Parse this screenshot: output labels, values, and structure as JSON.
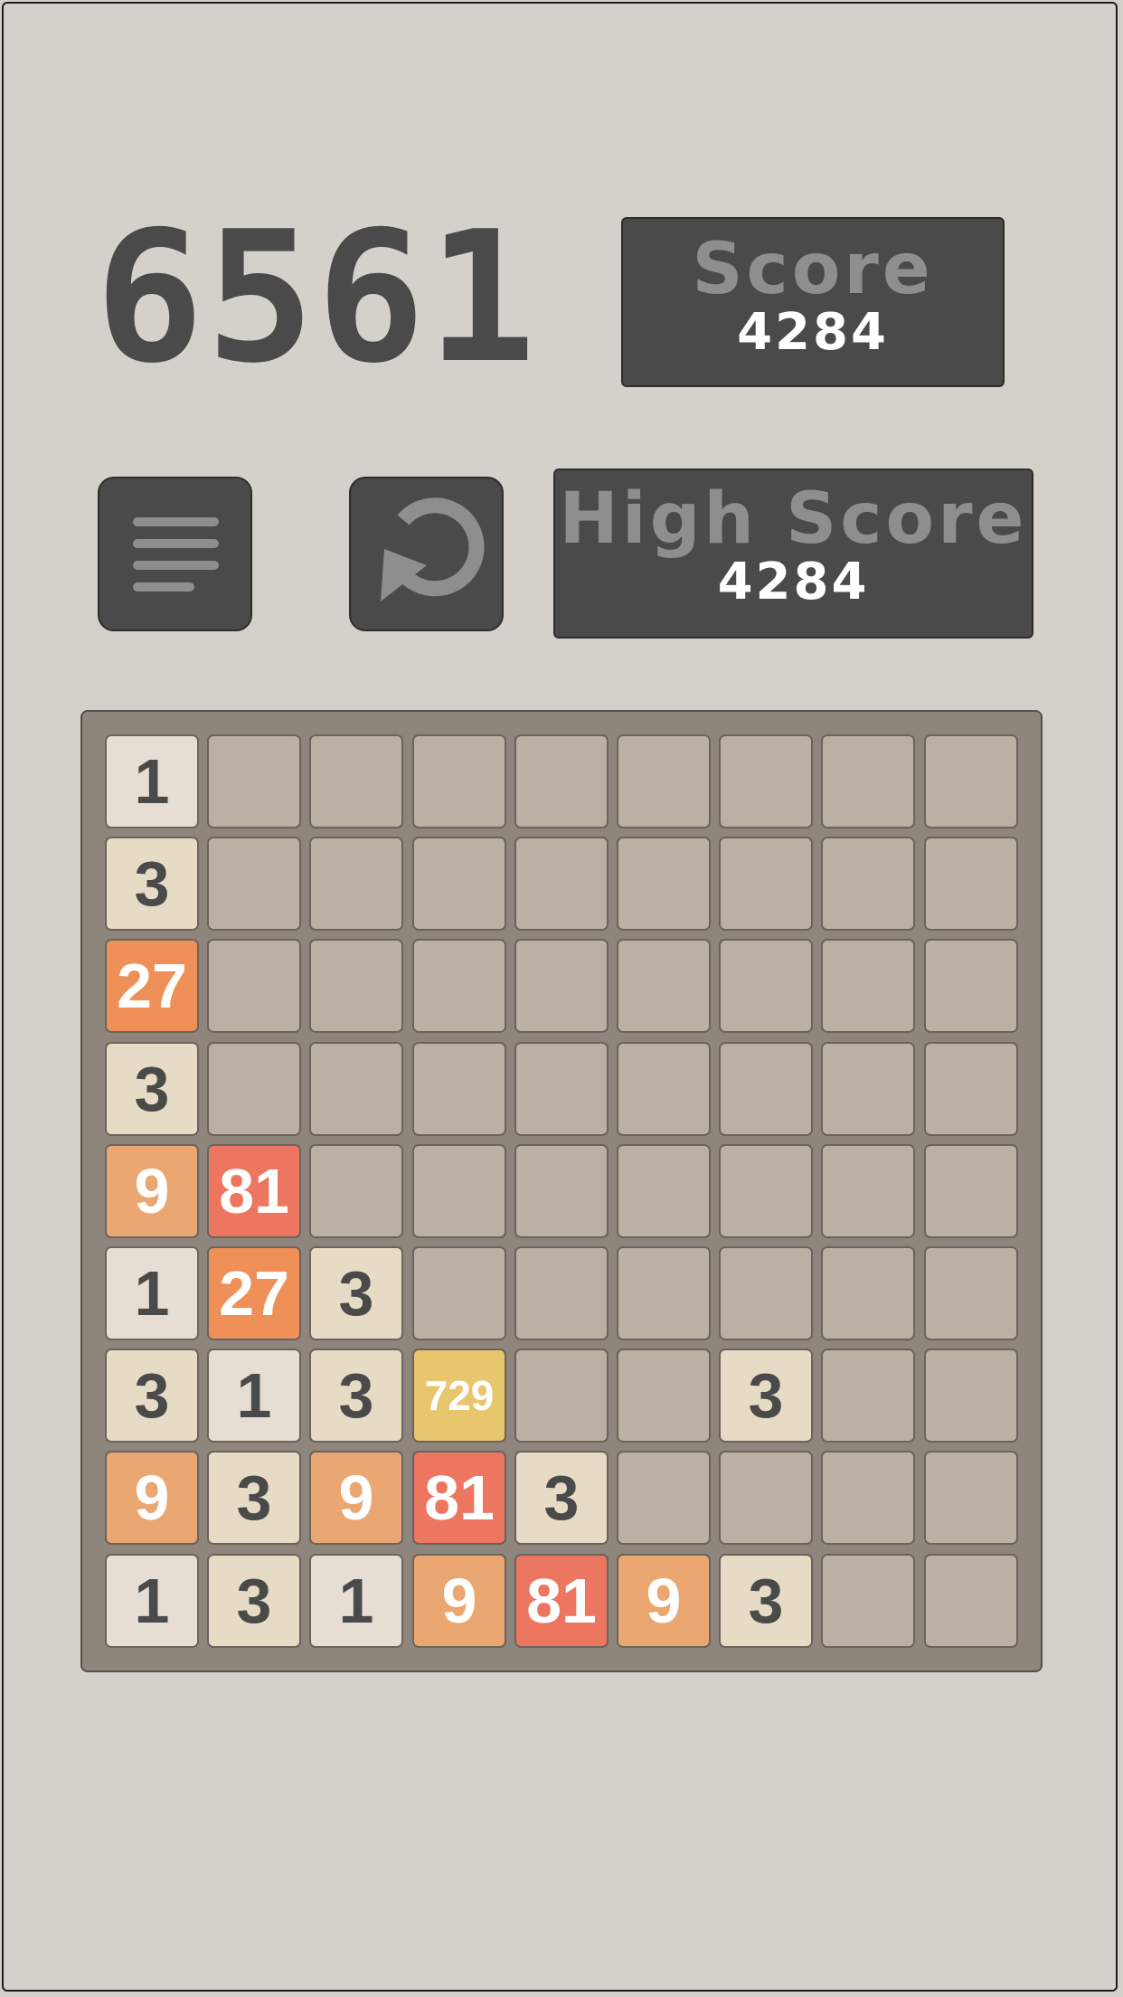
{
  "game": {
    "goal_tile": "6561",
    "score_label": "Score",
    "score_value": "4284",
    "high_score_label": "High Score",
    "high_score_value": "4284"
  },
  "colors": {
    "background": "#d4d1ca",
    "panel": "#4a4a4a",
    "panel_label": "#8e8e8e",
    "board": "#8e857c",
    "empty_cell": "#bab0a4",
    "tile_1": "#e6ded4",
    "tile_3": "#e6dbc4",
    "tile_9": "#eaa772",
    "tile_27": "#ee9057",
    "tile_81": "#ec765f",
    "tile_729": "#e7c66e"
  },
  "icons": {
    "menu": "menu-icon",
    "restart": "restart-icon"
  },
  "board": {
    "size": 9,
    "rows": [
      [
        "1",
        "",
        "",
        "",
        "",
        "",
        "",
        "",
        ""
      ],
      [
        "3",
        "",
        "",
        "",
        "",
        "",
        "",
        "",
        ""
      ],
      [
        "27",
        "",
        "",
        "",
        "",
        "",
        "",
        "",
        ""
      ],
      [
        "3",
        "",
        "",
        "",
        "",
        "",
        "",
        "",
        ""
      ],
      [
        "9",
        "81",
        "",
        "",
        "",
        "",
        "",
        "",
        ""
      ],
      [
        "1",
        "27",
        "3",
        "",
        "",
        "",
        "",
        "",
        ""
      ],
      [
        "3",
        "1",
        "3",
        "729",
        "",
        "",
        "3",
        "",
        ""
      ],
      [
        "9",
        "3",
        "9",
        "81",
        "3",
        "",
        "",
        "",
        ""
      ],
      [
        "1",
        "3",
        "1",
        "9",
        "81",
        "9",
        "3",
        "",
        ""
      ]
    ]
  }
}
